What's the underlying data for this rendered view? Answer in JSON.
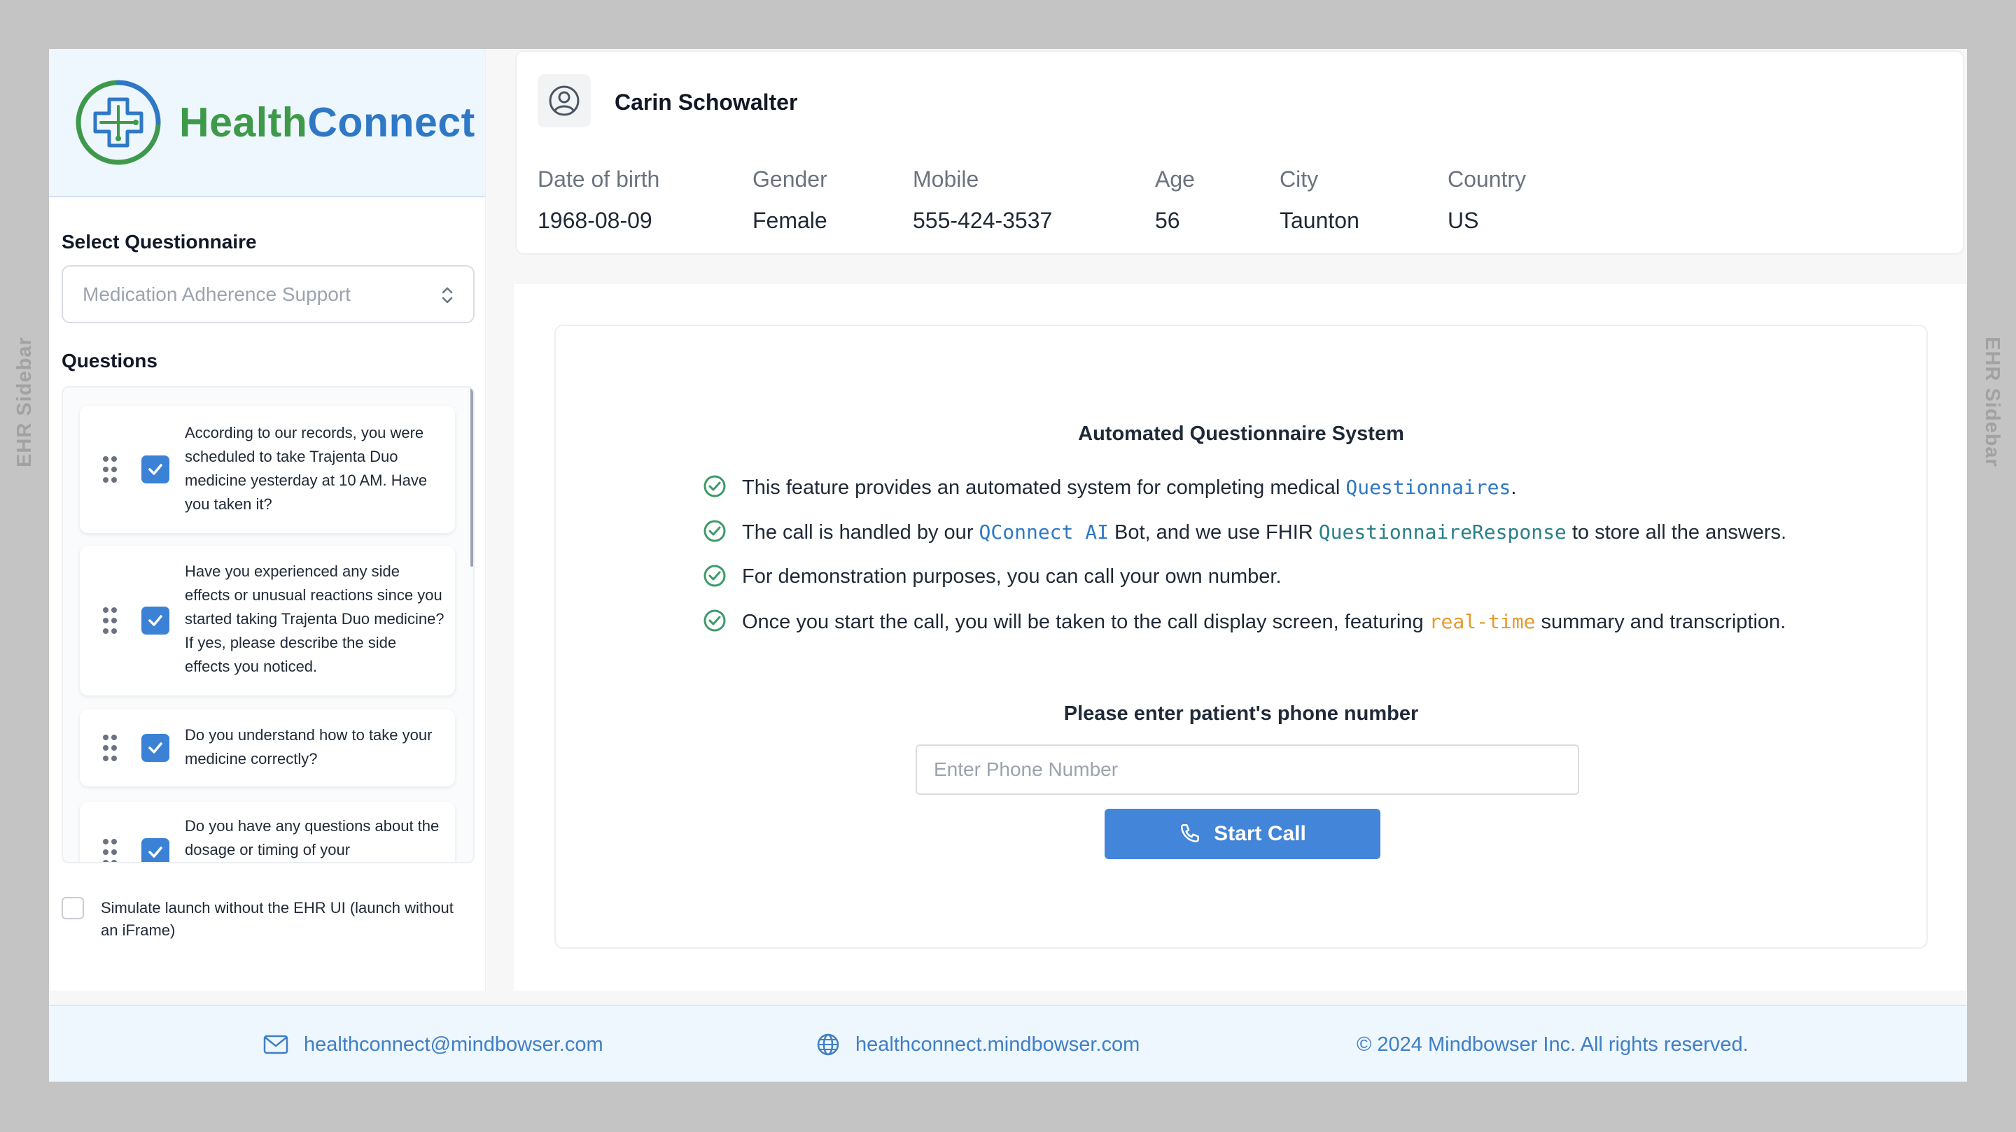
{
  "ehr_sidebar": {
    "left_label": "EHR Sidebar",
    "right_label": "EHR Sidebar"
  },
  "brand": {
    "name_part1": "Health",
    "name_part2": "Connect",
    "green": "#3e9a4a",
    "blue": "#2f78c5"
  },
  "sidebar": {
    "select_label": "Select Questionnaire",
    "select_value": "Medication Adherence Support",
    "questions_label": "Questions",
    "questions": [
      {
        "text": "According to our records, you were scheduled to take Trajenta Duo medicine yesterday at 10 AM. Have you taken it?",
        "checked": true
      },
      {
        "text": "Have you experienced any side effects or unusual reactions since you started taking Trajenta Duo medicine? If yes, please describe the side effects you noticed.",
        "checked": true
      },
      {
        "text": "Do you understand how to take your medicine correctly?",
        "checked": true
      },
      {
        "text": "Do you have any questions about the dosage or timing of your",
        "checked": true
      }
    ],
    "simulate_label": "Simulate launch without the EHR UI (launch without an iFrame)",
    "simulate_checked": false
  },
  "patient": {
    "name": "Carin Schowalter",
    "fields": [
      {
        "label": "Date of birth",
        "value": "1968-08-09"
      },
      {
        "label": "Gender",
        "value": "Female"
      },
      {
        "label": "Mobile",
        "value": "555-424-3537"
      },
      {
        "label": "Age",
        "value": "56"
      },
      {
        "label": "City",
        "value": "Taunton"
      },
      {
        "label": "Country",
        "value": "US"
      }
    ]
  },
  "main": {
    "title": "Automated Questionnaire System",
    "bullets": {
      "b1_pre": "This feature provides an automated system for completing medical ",
      "b1_code": "Questionnaires",
      "b1_post": ".",
      "b2_pre": "The call is handled by our ",
      "b2_code1": "QConnect AI",
      "b2_mid": " Bot, and we use FHIR ",
      "b2_code2": "QuestionnaireResponse",
      "b2_post": " to store all the answers.",
      "b3": "For demonstration purposes, you can call your own number.",
      "b4_pre": "Once you start the call, you will be taken to the call display screen, featuring ",
      "b4_code": "real-time",
      "b4_post": " summary and transcription."
    },
    "phone_label": "Please enter patient's phone number",
    "phone_placeholder": "Enter Phone Number",
    "phone_value": "",
    "start_button": "Start Call",
    "accent": "#4285d9"
  },
  "footer": {
    "email": "healthconnect@mindbowser.com",
    "website": "healthconnect.mindbowser.com",
    "copyright": "© 2024 Mindbowser Inc. All rights reserved."
  }
}
